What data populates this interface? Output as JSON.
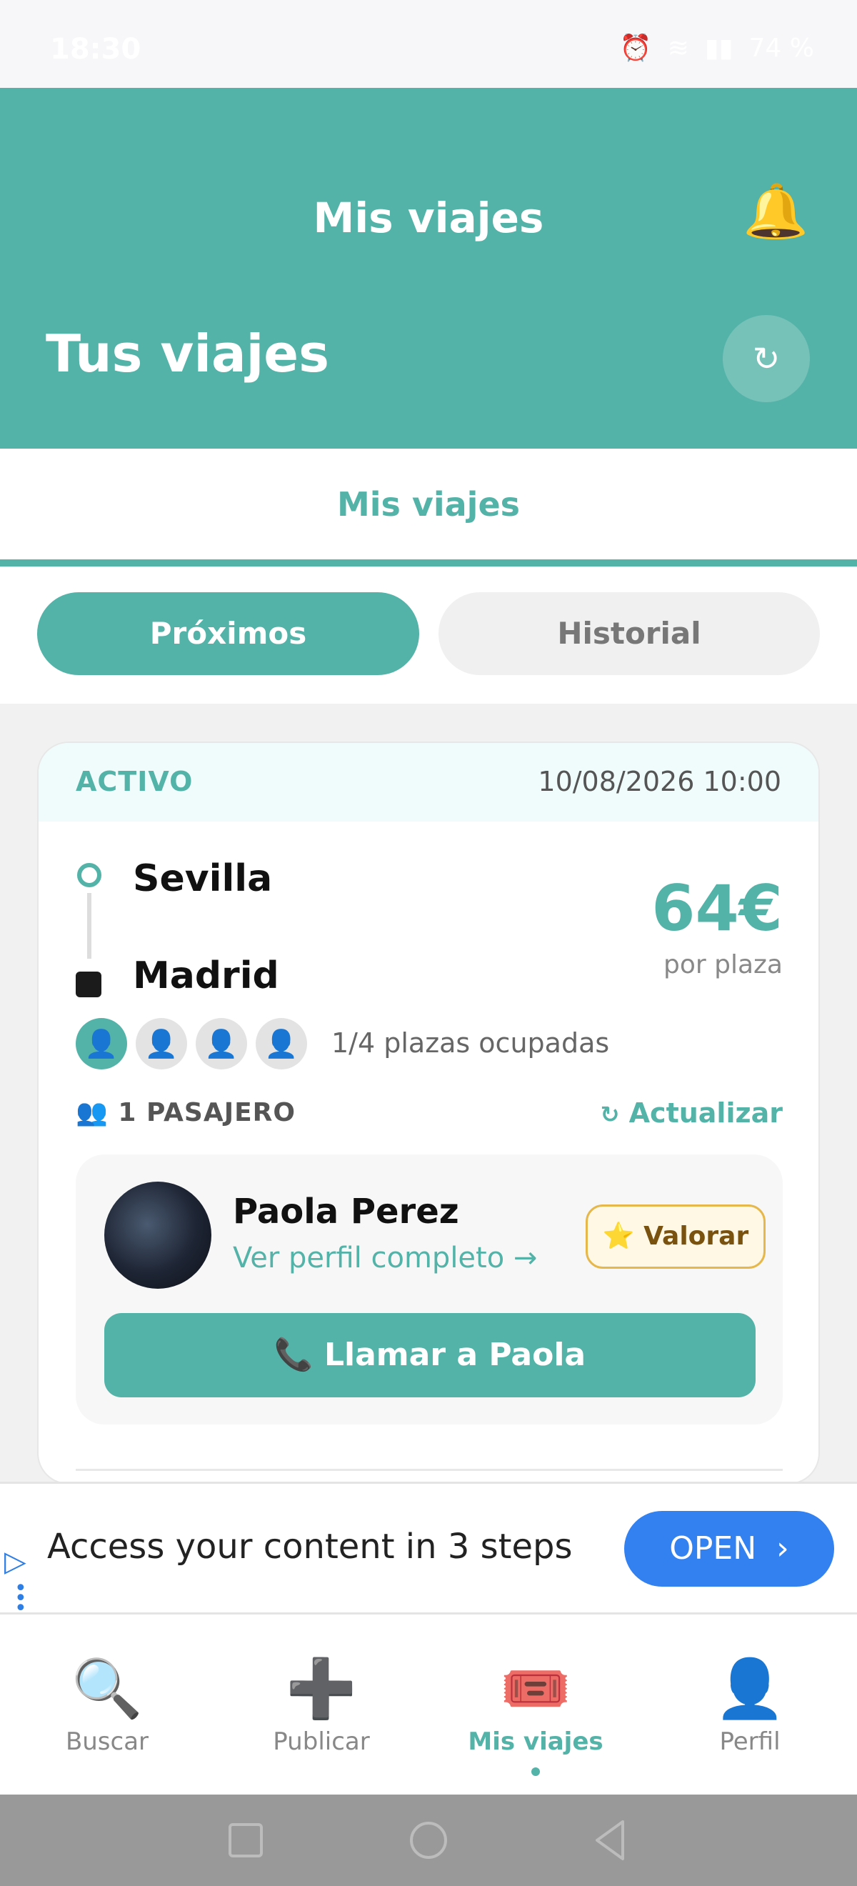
{
  "status_bar": {
    "time": "18:30",
    "battery": "74 %"
  },
  "header": {
    "title": "Mis viajes",
    "section_title": "Tus viajes",
    "bell_icon": "🔔",
    "refresh_icon": "↻"
  },
  "tabs": {
    "active": "Mis viajes"
  },
  "segments": {
    "upcoming": "Próximos",
    "history": "Historial",
    "selected": "upcoming"
  },
  "trip": {
    "status": "ACTIVO",
    "datetime": "10/08/2026 10:00",
    "origin": "Sevilla",
    "destination": "Madrid",
    "price": "64€",
    "price_unit": "por plaza",
    "seats_total": 4,
    "seats_occupied": 1,
    "seats_text": "1/4 plazas ocupadas",
    "passengers_heading": "1 PASAJERO",
    "passengers_icon": "👥",
    "update_icon": "↻",
    "update_label": "Actualizar",
    "passenger": {
      "name": "Paola Perez",
      "profile_link": "Ver perfil completo →",
      "rate_label": "Valorar",
      "rate_icon": "⭐",
      "call_label": "Llamar a Paola",
      "call_icon": "📞"
    }
  },
  "ad": {
    "text": "Access your content in 3 steps",
    "cta": "OPEN"
  },
  "bottom_nav": {
    "items": [
      {
        "label": "Buscar",
        "icon": "🔍"
      },
      {
        "label": "Publicar",
        "icon": "➕"
      },
      {
        "label": "Mis viajes",
        "icon": "🎟️"
      },
      {
        "label": "Perfil",
        "icon": "👤"
      }
    ],
    "active_index": 2
  },
  "colors": {
    "accent": "#54b3a8",
    "ad_button": "#3381f1",
    "rate_border": "#e6b84c"
  }
}
